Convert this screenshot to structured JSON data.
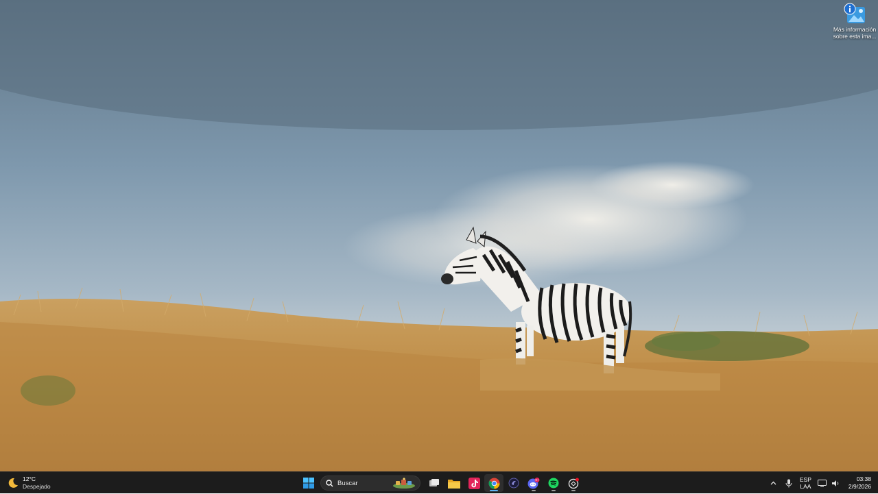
{
  "desktop": {
    "icon_label": "Más información sobre esta ima..."
  },
  "taskbar": {
    "weather": {
      "temperature": "12°C",
      "condition": "Despejado"
    },
    "search": {
      "label": "Buscar"
    },
    "pinned": [
      "start-icon",
      "task-view-icon",
      "file-explorer-icon",
      "tiktok-icon",
      "chrome-icon",
      "app-icon",
      "discord-icon",
      "spotify-icon",
      "chatgpt-icon"
    ],
    "discord_badge": "9+",
    "tray": {
      "language_line1": "ESP",
      "language_line2": "LAA",
      "time": "03:38",
      "date": "2/9/2026"
    }
  },
  "colors": {
    "taskbar_bg": "#1c1c1c",
    "accent": "#5fb2f2"
  }
}
